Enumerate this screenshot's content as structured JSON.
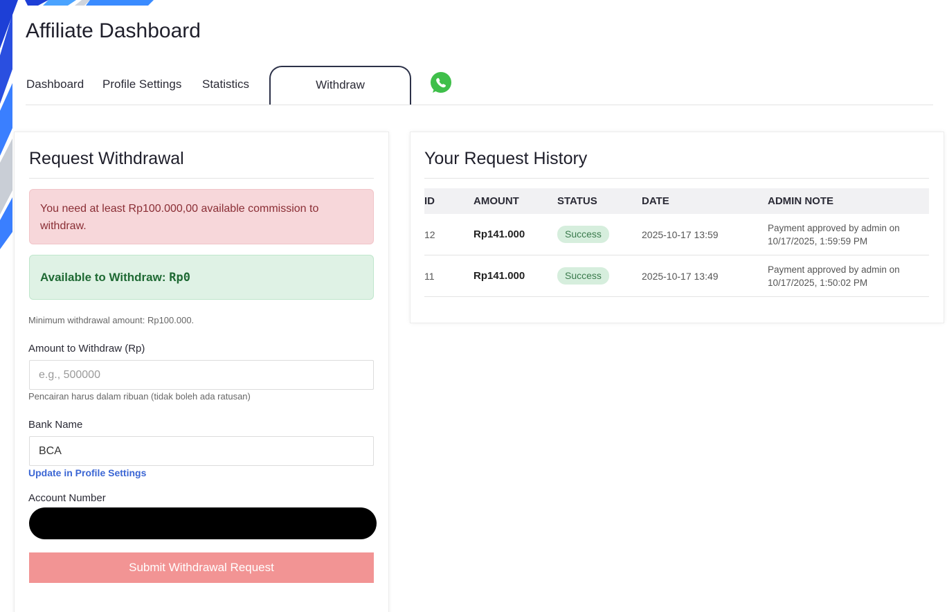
{
  "header": {
    "title": "Affiliate Dashboard"
  },
  "tabs": [
    {
      "label": "Dashboard"
    },
    {
      "label": "Profile Settings"
    },
    {
      "label": "Statistics"
    },
    {
      "label": "Withdraw",
      "active": true
    }
  ],
  "whatsapp": {
    "icon": "whatsapp-icon",
    "color": "#3fbf4a"
  },
  "request": {
    "title": "Request Withdrawal",
    "alert_text": "You need at least Rp100.000,00 available commission to withdraw.",
    "available_label": "Available to Withdraw: ",
    "available_amount": "Rp0",
    "min_note": "Minimum withdrawal amount: Rp100.000.",
    "amount_label": "Amount to Withdraw (Rp)",
    "amount_placeholder": "e.g., 500000",
    "amount_help": "Pencairan harus dalam ribuan (tidak boleh ada ratusan)",
    "bank_label": "Bank Name",
    "bank_value": "BCA",
    "update_link": "Update in Profile Settings",
    "account_label": "Account Number",
    "submit_label": "Submit Withdrawal Request"
  },
  "history": {
    "title": "Your Request History",
    "columns": [
      "ID",
      "AMOUNT",
      "STATUS",
      "DATE",
      "ADMIN NOTE"
    ],
    "rows": [
      {
        "id": "12",
        "amount": "Rp141.000",
        "status": "Success",
        "date": "2025-10-17 13:59",
        "note": "Payment approved by admin on 10/17/2025, 1:59:59 PM"
      },
      {
        "id": "11",
        "amount": "Rp141.000",
        "status": "Success",
        "date": "2025-10-17 13:49",
        "note": "Payment approved by admin on 10/17/2025, 1:50:02 PM"
      }
    ]
  },
  "colors": {
    "accent_blue": "#2f6fe0",
    "danger_bg": "#f7d7da",
    "success_bg": "#dff2e5",
    "submit_bg": "#f29494"
  }
}
